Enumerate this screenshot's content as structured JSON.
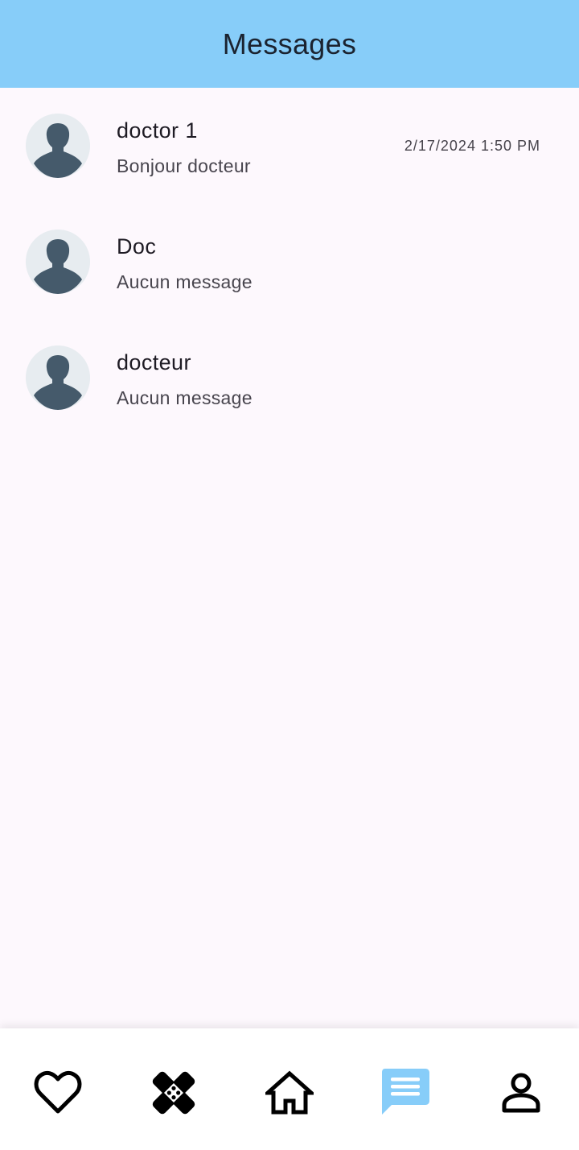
{
  "header": {
    "title": "Messages"
  },
  "conversations": [
    {
      "name": "doctor 1",
      "preview": "Bonjour docteur",
      "time": "2/17/2024 1:50 PM"
    },
    {
      "name": "Doc",
      "preview": "Aucun message",
      "time": ""
    },
    {
      "name": "docteur",
      "preview": "Aucun message",
      "time": ""
    }
  ],
  "bottom_nav": {
    "items": [
      {
        "icon": "heart-icon"
      },
      {
        "icon": "bandage-icon"
      },
      {
        "icon": "home-icon"
      },
      {
        "icon": "chat-icon",
        "active": true
      },
      {
        "icon": "person-icon"
      }
    ],
    "active_color": "#87cdf9"
  },
  "colors": {
    "appbar": "#87cdf9",
    "background": "#fdf8fd",
    "avatar_bg": "#e7ecf0",
    "avatar_fg": "#455a6b"
  }
}
